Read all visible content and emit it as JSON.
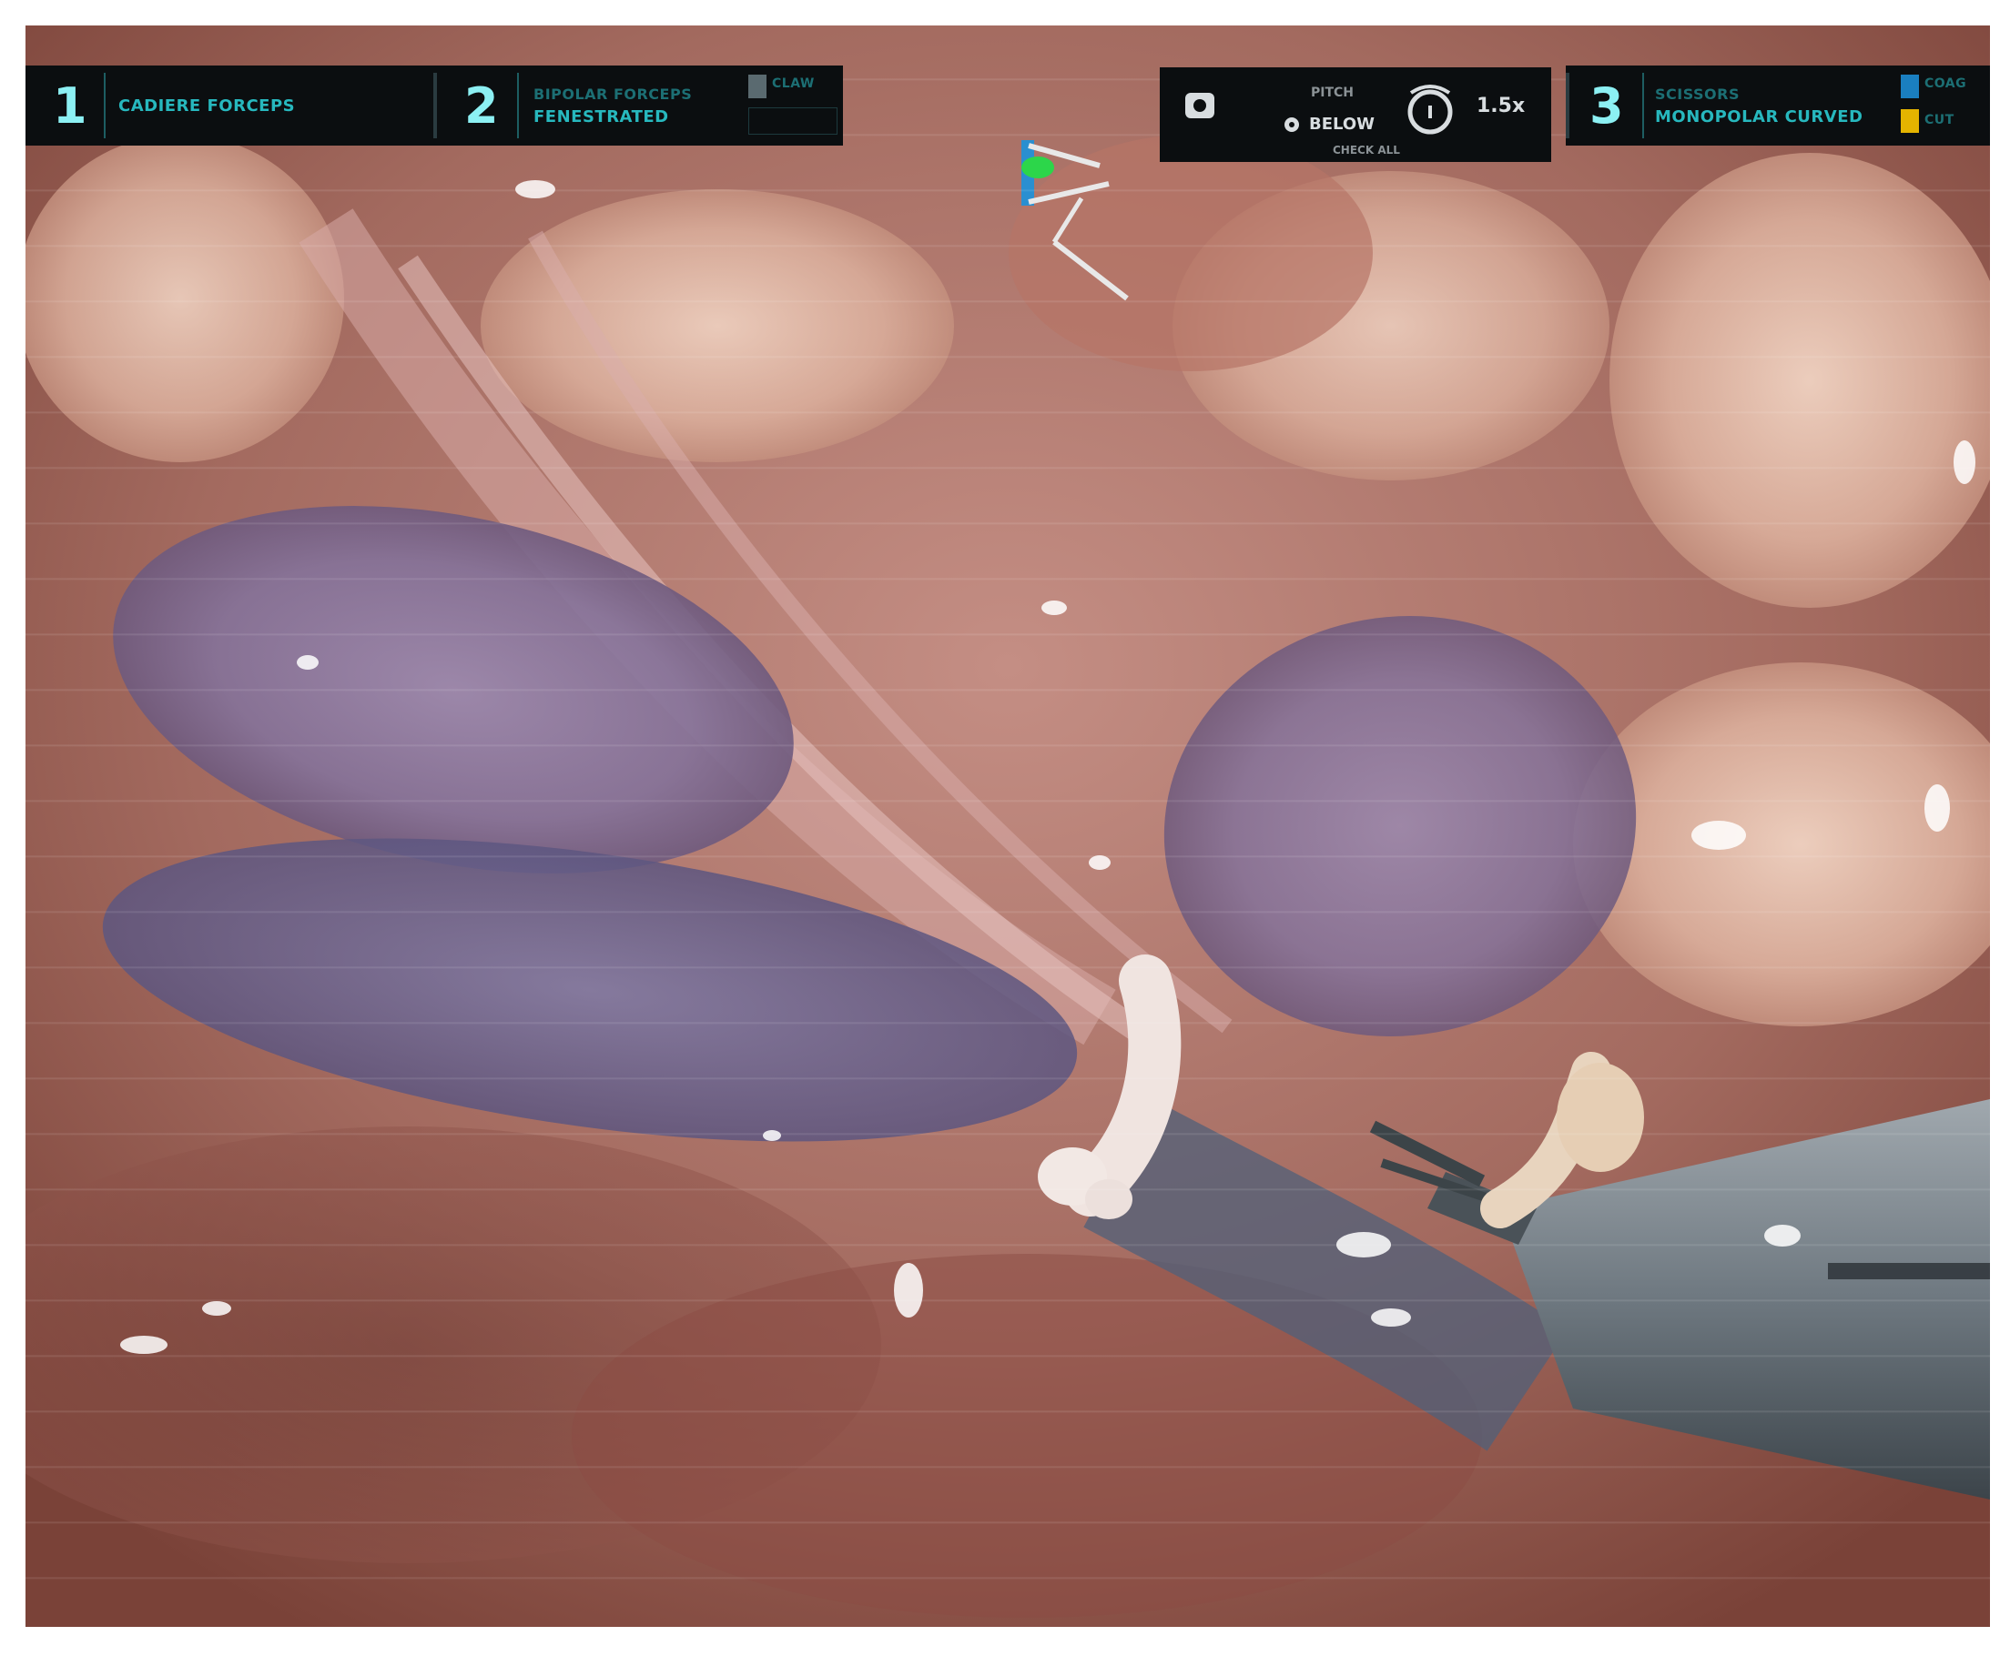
{
  "hud": {
    "arm1": {
      "number": "1",
      "instrument": "CADIERE FORCEPS"
    },
    "arm2": {
      "number": "2",
      "instrument_line1": "BIPOLAR FORCEPS",
      "instrument_line2": "FENESTRATED",
      "tag": "CLAW"
    },
    "camera": {
      "label_top": "PITCH",
      "mode": "BELOW",
      "zoom": "1.5x",
      "footer": "CHECK ALL"
    },
    "arm3": {
      "number": "3",
      "instrument_line1": "SCISSORS",
      "instrument_line2": "MONOPOLAR CURVED",
      "tag_blue": "COAG",
      "tag_yellow": "CUT"
    }
  },
  "colors": {
    "hud_background": "#0b0e10",
    "hud_accent": "#3bd3d8",
    "cut_tag": "#e4b400",
    "coag_tag": "#1a7fc0",
    "tissue_base": "#a26a60"
  },
  "icons": [
    "camera-icon",
    "pitch-dial-icon",
    "orientation-marker-icon"
  ]
}
